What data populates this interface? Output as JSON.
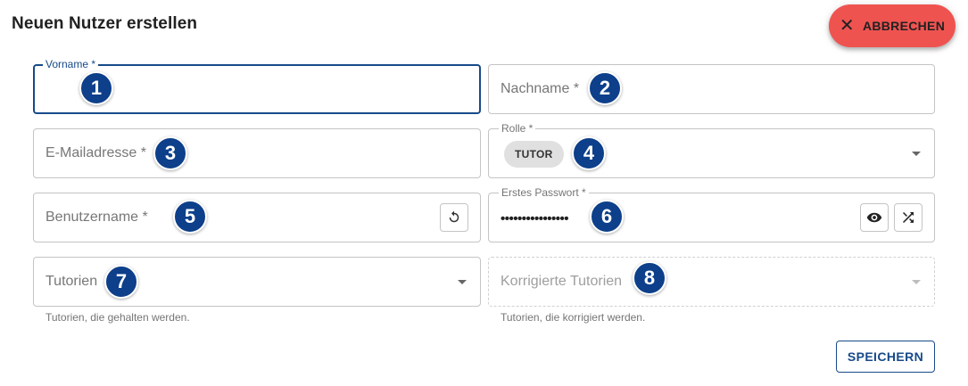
{
  "dialog": {
    "title": "Neuen Nutzer erstellen",
    "cancel_label": "ABBRECHEN",
    "save_label": "SPEICHERN"
  },
  "fields": {
    "firstname": {
      "label": "Vorname *",
      "badge": "1"
    },
    "lastname": {
      "placeholder": "Nachname *",
      "badge": "2"
    },
    "email": {
      "placeholder": "E-Mailadresse *",
      "badge": "3"
    },
    "role": {
      "label": "Rolle *",
      "selected": "TUTOR",
      "badge": "4"
    },
    "username": {
      "placeholder": "Benutzername *",
      "badge": "5"
    },
    "password": {
      "label": "Erstes Passwort *",
      "value": "••••••••••••••••",
      "badge": "6"
    },
    "tutorials": {
      "placeholder": "Tutorien",
      "hint": "Tutorien, die gehalten werden.",
      "badge": "7"
    },
    "corrected_tutorials": {
      "placeholder": "Korrigierte Tutorien",
      "hint": "Tutorien, die korrigiert werden.",
      "badge": "8"
    }
  },
  "icons": {
    "cancel": "close-icon",
    "regenerate_username": "refresh-icon",
    "show_password": "eye-icon",
    "generate_password": "shuffle-icon",
    "dropdown": "arrow-drop-down-icon"
  },
  "colors": {
    "accent": "#174a8a",
    "cancel_button": "#ef5350",
    "badge": "#0d3f8a",
    "chip": "#e0e0e0"
  }
}
